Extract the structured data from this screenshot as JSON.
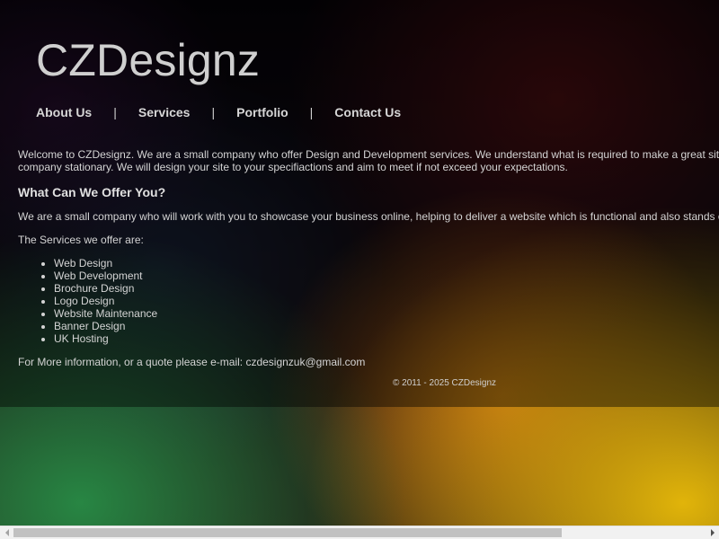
{
  "site": {
    "title": "CZDesignz"
  },
  "nav": {
    "items": [
      {
        "label": "About Us"
      },
      {
        "label": "Services"
      },
      {
        "label": "Portfolio"
      },
      {
        "label": "Contact Us"
      }
    ],
    "separator": "|"
  },
  "intro": {
    "line1": "Welcome to CZDesignz. We are a small company who offer Design and Development services. We understand what is required to make a great site",
    "line2": "company stationary. We will design your site to your specifiactions and aim to meet if not exceed your expectations."
  },
  "offer": {
    "heading": "What Can We Offer You?",
    "text": "We are a small company who will work with you to showcase your business online, helping to deliver a website which is functional and also stands o"
  },
  "services": {
    "intro": "The Services we offer are:",
    "items": [
      "Web Design",
      "Web Development",
      "Brochure Design",
      "Logo Design",
      "Website Maintenance",
      "Banner Design",
      "UK Hosting"
    ]
  },
  "contact": {
    "text": "For More information, or a quote please e-mail: czdesignzuk@gmail.com"
  },
  "footer": {
    "copyright": "© 2011 - 2025 CZDesignz"
  },
  "colors": {
    "text": "#d4d4d4",
    "scrollbar_track": "#f1f1f1",
    "scrollbar_thumb": "#c1c1c1"
  },
  "icons": {
    "scroll_left": "triangle-left-icon",
    "scroll_right": "triangle-right-icon"
  }
}
